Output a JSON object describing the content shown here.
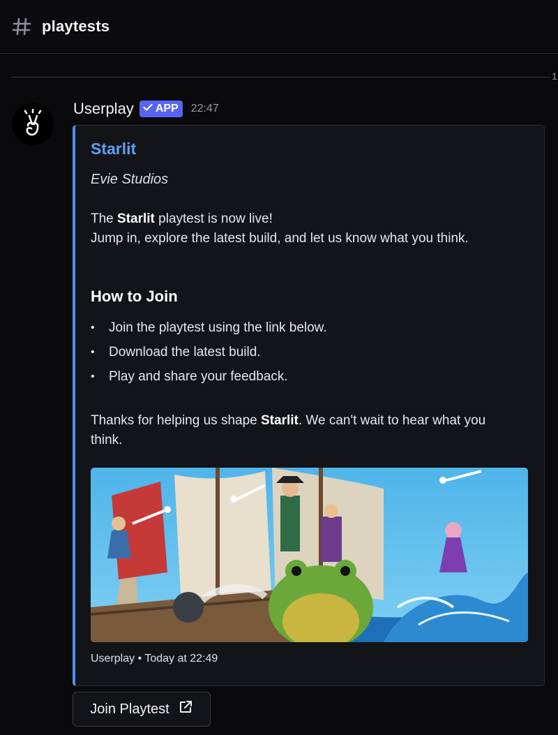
{
  "channel": {
    "name": "playtests",
    "icon": "hash-icon"
  },
  "divider": {
    "text": "1"
  },
  "message": {
    "author": "Userplay",
    "badge": "APP",
    "time": "22:47",
    "avatar_icon": "peace-hand-icon"
  },
  "embed": {
    "accent_color": "#4e8ef0",
    "title": "Starlit",
    "author": "Evie Studios",
    "intro_prefix": "The ",
    "intro_bold": "Starlit",
    "intro_suffix": " playtest is now live!",
    "intro_line2": "Jump in, explore the latest build, and let us know what you think.",
    "section_heading": "How to Join",
    "steps": [
      "Join the playtest using the link below.",
      "Download the latest build.",
      "Play and share your feedback."
    ],
    "thanks_prefix": "Thanks for helping us shape ",
    "thanks_bold": "Starlit",
    "thanks_suffix": ". We can't wait to hear what you",
    "thanks_line2": "think.",
    "image_desc_icon": "pirate-ship-artwork-image",
    "footer": "Userplay • Today at 22:49"
  },
  "button": {
    "label": "Join Playtest",
    "icon": "external-link-icon"
  }
}
